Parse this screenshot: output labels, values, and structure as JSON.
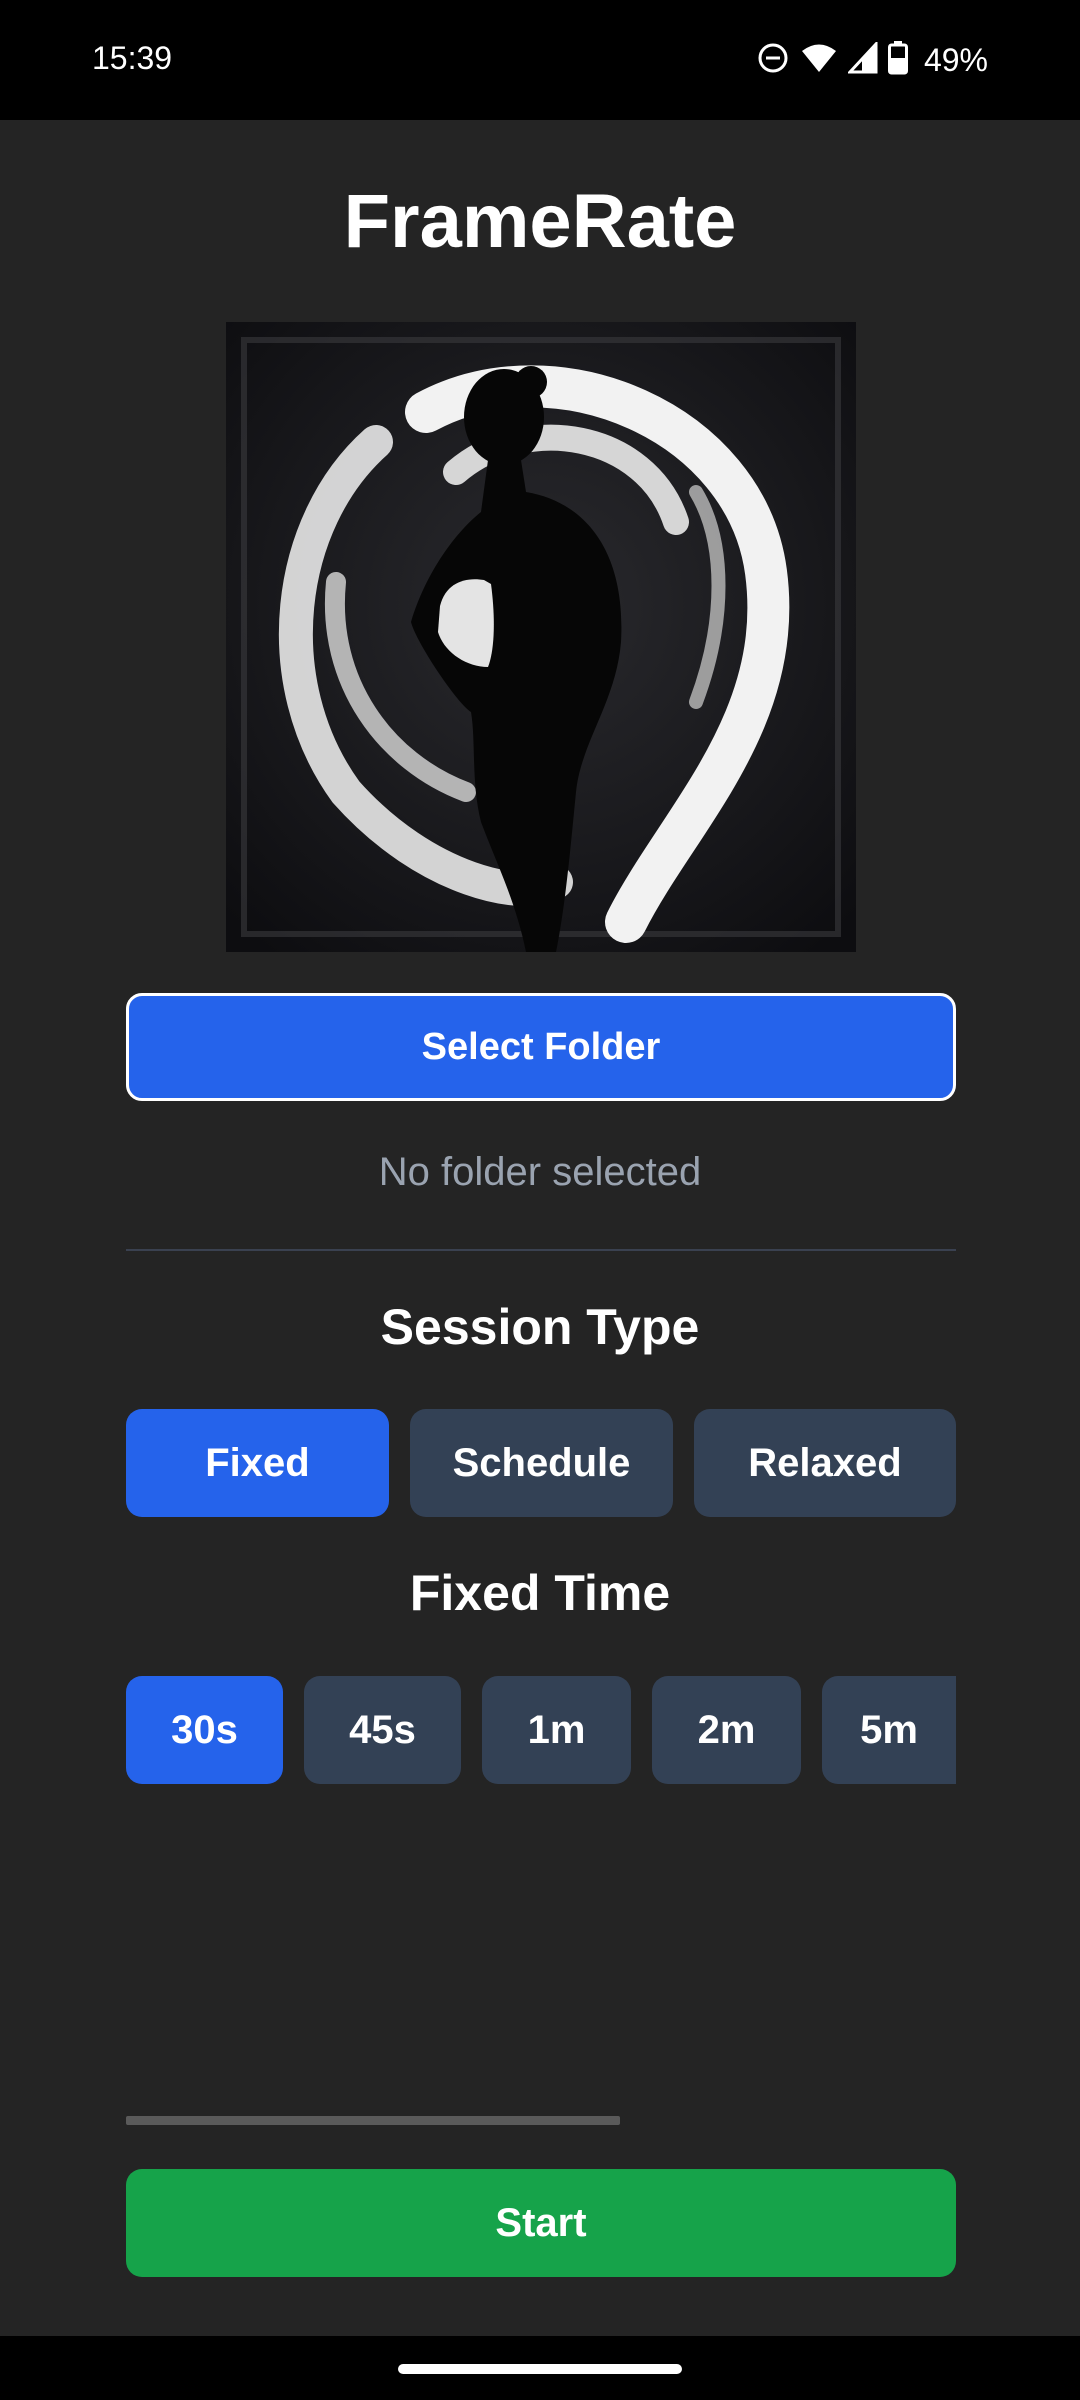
{
  "status_bar": {
    "time": "15:39",
    "battery": "49%"
  },
  "app": {
    "title": "FrameRate"
  },
  "folder": {
    "select_label": "Select Folder",
    "status": "No folder selected"
  },
  "session": {
    "title": "Session Type",
    "options": [
      "Fixed",
      "Schedule",
      "Relaxed"
    ],
    "selected": "Fixed"
  },
  "fixed_time": {
    "title": "Fixed Time",
    "options": [
      "30s",
      "45s",
      "1m",
      "2m",
      "5m"
    ],
    "selected": "30s"
  },
  "actions": {
    "start_label": "Start"
  },
  "colors": {
    "accent": "#2563eb",
    "start": "#16a34a",
    "inactive_button": "#334155",
    "background": "#242424"
  }
}
